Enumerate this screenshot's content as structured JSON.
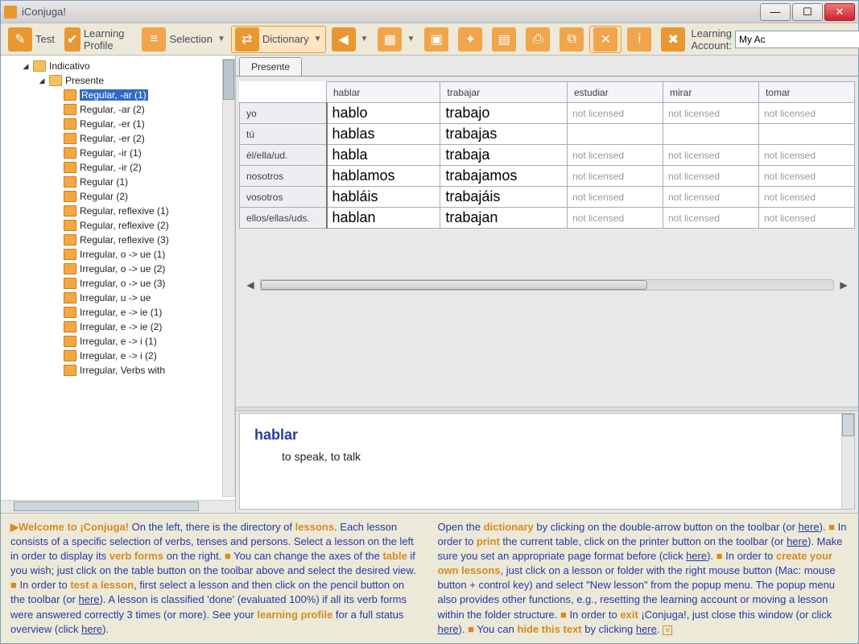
{
  "window": {
    "title": "iConjuga!"
  },
  "toolbar": {
    "test": "Test",
    "learning_profile": "Learning Profile",
    "selection": "Selection",
    "dictionary": "Dictionary",
    "account_label": "Learning Account:",
    "account_value": "My Ac"
  },
  "tree": {
    "root": "Indicativo",
    "tense": "Presente",
    "items": [
      "Regular, -ar (1)",
      "Regular, -ar (2)",
      "Regular, -er (1)",
      "Regular, -er (2)",
      "Regular, -ir (1)",
      "Regular, -ir (2)",
      "Regular (1)",
      "Regular (2)",
      "Regular, reflexive (1)",
      "Regular, reflexive (2)",
      "Regular, reflexive (3)",
      "Irregular, o -> ue (1)",
      "Irregular, o -> ue (2)",
      "Irregular, o -> ue (3)",
      "Irregular, u -> ue",
      "Irregular, e -> ie (1)",
      "Irregular, e -> ie (2)",
      "Irregular, e -> i (1)",
      "Irregular, e -> i (2)",
      "Irregular, Verbs with"
    ],
    "selected_index": 0
  },
  "tab": "Presente",
  "grid": {
    "columns": [
      "hablar",
      "trabajar",
      "estudiar",
      "mirar",
      "tomar"
    ],
    "pronouns": [
      "yo",
      "tú",
      "él/ella/ud.",
      "nosotros",
      "vosotros",
      "ellos/ellas/uds."
    ],
    "cells": [
      [
        "hablo",
        "trabajo",
        "not licensed",
        "not licensed",
        "not licensed"
      ],
      [
        "hablas",
        "trabajas",
        "",
        "",
        ""
      ],
      [
        "habla",
        "trabaja",
        "not licensed",
        "not licensed",
        "not licensed"
      ],
      [
        "hablamos",
        "trabajamos",
        "not licensed",
        "not licensed",
        "not licensed"
      ],
      [
        "habláis",
        "trabajáis",
        "not licensed",
        "not licensed",
        "not licensed"
      ],
      [
        "hablan",
        "trabajan",
        "not licensed",
        "not licensed",
        "not licensed"
      ]
    ],
    "dim_from_col": 2
  },
  "detail": {
    "word": "hablar",
    "definition": "to speak, to talk"
  },
  "help": {
    "col1_parts": {
      "welcome": "Welcome to ¡Conjuga!",
      "t1": " On the left, there is the directory of ",
      "lessons": "lessons",
      "t2": ". Each lesson consists of a specific selection of verbs, tenses and persons. Select a lesson on the left in order to display its ",
      "verbforms": "verb forms",
      "t3": " on the right. ",
      "t4": " You can change the axes of the ",
      "table": "table",
      "t5": " if you wish; just click on the table button on the toolbar above and select the desired view. ",
      "t6": " In order to ",
      "testlesson": "test a lesson",
      "t7": ", first select a lesson and then click on the pencil button on the toolbar (or ",
      "here1": "here",
      "t8": "). A lesson is classified 'done' (evaluated 100%) if all its verb forms were answered correctly 3 times (or more). See your ",
      "lp": "learning profile",
      "t9": " for a full status overview (click ",
      "here2": "here",
      "t10": ")."
    },
    "col2_parts": {
      "t1": "Open the ",
      "dict": "dictionary",
      "t2": " by clicking on the double-arrow button on the toolbar (or ",
      "here1": "here",
      "t3": "). ",
      "t4": " In order to ",
      "print": "print",
      "t5": " the current table, click on the printer button on the toolbar (or ",
      "here2": "here",
      "t6": "). Make sure you set an appropriate page format before (click ",
      "here3": "here",
      "t7": "). ",
      "t8": " In order to ",
      "create": "create your own lessons",
      "t9": ", just click on a lesson or folder with the right mouse button (Mac: mouse button + control key) and select \"New lesson\" from the popup menu. The popup menu also provides other functions, e.g., resetting the learning account or moving a lesson within the folder structure. ",
      "t10": " In order to ",
      "exit": "exit",
      "t11": " ¡Conjuga!, just close this window (or click ",
      "here4": "here",
      "t12": "). ",
      "t13": " You can ",
      "hide": "hide this text",
      "t14": " by clicking ",
      "here5": "here",
      "t15": ". "
    }
  }
}
